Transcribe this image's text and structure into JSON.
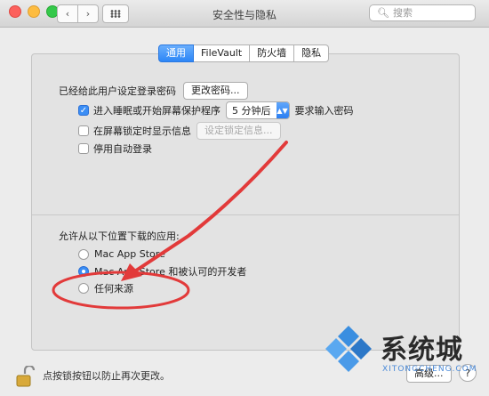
{
  "window": {
    "title": "安全性与隐私",
    "search_placeholder": "搜索"
  },
  "tabs": [
    {
      "label": "通用",
      "active": true
    },
    {
      "label": "FileVault",
      "active": false
    },
    {
      "label": "防火墙",
      "active": false
    },
    {
      "label": "隐私",
      "active": false
    }
  ],
  "general": {
    "password_label": "已经给此用户设定登录密码",
    "change_password_button": "更改密码...",
    "require_password": {
      "checked": true,
      "label_before": "进入睡眠或开始屏幕保护程序",
      "delay_value": "5 分钟后",
      "label_after": "要求输入密码"
    },
    "show_message": {
      "checked": false,
      "label": "在屏幕锁定时显示信息",
      "button": "设定锁定信息..."
    },
    "disable_autologin": {
      "checked": false,
      "label": "停用自动登录"
    }
  },
  "downloads": {
    "heading": "允许从以下位置下载的应用:",
    "options": [
      {
        "label": "Mac App Store",
        "selected": false
      },
      {
        "label": "Mac App Store 和被认可的开发者",
        "selected": true
      },
      {
        "label": "任何来源",
        "selected": false
      }
    ]
  },
  "footer": {
    "lock_text": "点按锁按钮以防止再次更改。",
    "advanced_button": "高级...",
    "help_button": "?"
  },
  "watermark": {
    "text": "系统城",
    "sub": "XITONGCHENG.COM"
  },
  "colors": {
    "accent": "#2c86f7",
    "annotation": "#e23a3a"
  }
}
